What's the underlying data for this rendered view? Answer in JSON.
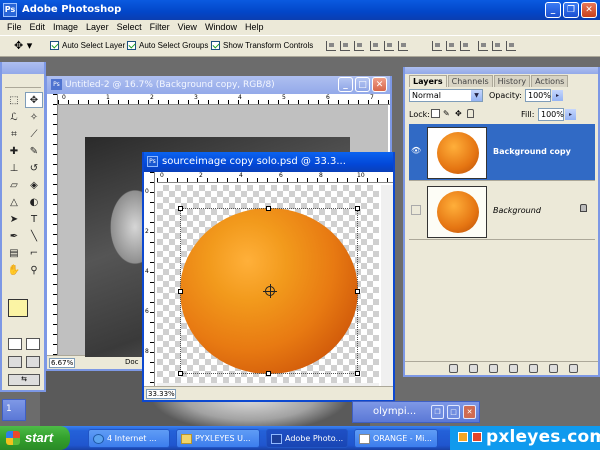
{
  "app": {
    "title": "Adobe Photoshop",
    "icon": "photoshop-icon"
  },
  "menu": [
    "File",
    "Edit",
    "Image",
    "Layer",
    "Select",
    "Filter",
    "View",
    "Window",
    "Help"
  ],
  "options": {
    "auto_select_layer": "Auto Select Layer",
    "auto_select_groups": "Auto Select Groups",
    "show_transform_controls": "Show Transform Controls"
  },
  "doc_untitled": {
    "title": "Untitled-2 @ 16.7% (Background copy, RGB/8)",
    "zoom": "6.67%",
    "status": "Doc",
    "ruler_numbers": [
      "0",
      "1",
      "2",
      "3",
      "4",
      "5",
      "6",
      "7"
    ]
  },
  "doc_source": {
    "title": "sourceimage copy solo.psd @ 33.3...",
    "zoom": "33.33%",
    "ruler_numbers": [
      "0",
      "2",
      "4",
      "6",
      "8",
      "10"
    ],
    "ruler_v_numbers": [
      "0",
      "2",
      "4",
      "6",
      "8"
    ]
  },
  "layers_panel": {
    "tabs": [
      "Layers",
      "Channels",
      "History",
      "Actions"
    ],
    "blend_mode": "Normal",
    "opacity_label": "Opacity:",
    "opacity_value": "100%",
    "lock_label": "Lock:",
    "fill_label": "Fill:",
    "fill_value": "100%",
    "layers": [
      {
        "name": "Background copy",
        "selected": true,
        "visible": true
      },
      {
        "name": "Background",
        "selected": false,
        "visible": false,
        "locked": true
      }
    ]
  },
  "minimized": {
    "left_label": "1",
    "olympic_title": "olympi..."
  },
  "taskbar": {
    "start": "start",
    "tasks": [
      "4 Internet ...",
      "PYXLEYES U...",
      "Adobe Photo...",
      "ORANGE - Mi..."
    ],
    "watermark": "pxleyes.com"
  }
}
